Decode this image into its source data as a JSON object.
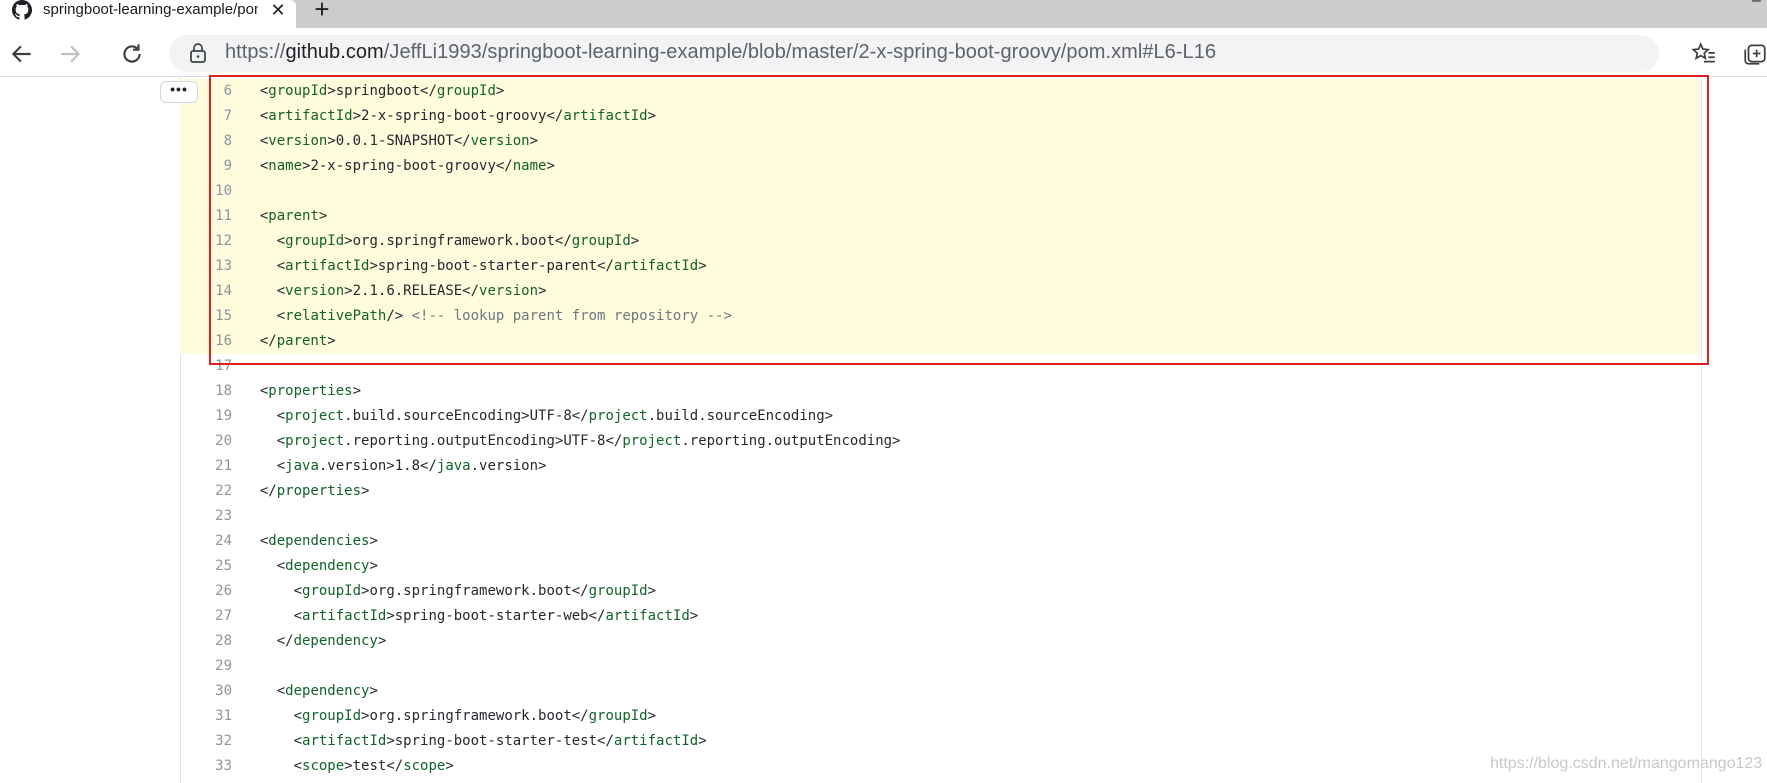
{
  "tab": {
    "title": "springboot-learning-example/pom.xml"
  },
  "address_bar": {
    "url_prefix": "https://",
    "host": "github.com",
    "path": "/JeffLi1993/springboot-learning-example/blob/master/2-x-spring-boot-groovy/pom.xml#L6-L16"
  },
  "expander": {
    "label": "•••"
  },
  "code_lines": [
    {
      "n": "6",
      "hl": true,
      "parts": [
        [
          "p",
          "  <"
        ],
        [
          "t",
          "groupId"
        ],
        [
          "p",
          ">springboot</"
        ],
        [
          "t",
          "groupId"
        ],
        [
          "p",
          ">"
        ]
      ]
    },
    {
      "n": "7",
      "hl": true,
      "parts": [
        [
          "p",
          "  <"
        ],
        [
          "t",
          "artifactId"
        ],
        [
          "p",
          ">2-x-spring-boot-groovy</"
        ],
        [
          "t",
          "artifactId"
        ],
        [
          "p",
          ">"
        ]
      ]
    },
    {
      "n": "8",
      "hl": true,
      "parts": [
        [
          "p",
          "  <"
        ],
        [
          "t",
          "version"
        ],
        [
          "p",
          ">0.0.1-SNAPSHOT</"
        ],
        [
          "t",
          "version"
        ],
        [
          "p",
          ">"
        ]
      ]
    },
    {
      "n": "9",
      "hl": true,
      "parts": [
        [
          "p",
          "  <"
        ],
        [
          "t",
          "name"
        ],
        [
          "p",
          ">2-x-spring-boot-groovy</"
        ],
        [
          "t",
          "name"
        ],
        [
          "p",
          ">"
        ]
      ]
    },
    {
      "n": "10",
      "hl": true,
      "parts": []
    },
    {
      "n": "11",
      "hl": true,
      "parts": [
        [
          "p",
          "  <"
        ],
        [
          "t",
          "parent"
        ],
        [
          "p",
          ">"
        ]
      ]
    },
    {
      "n": "12",
      "hl": true,
      "parts": [
        [
          "p",
          "    <"
        ],
        [
          "t",
          "groupId"
        ],
        [
          "p",
          ">org.springframework.boot</"
        ],
        [
          "t",
          "groupId"
        ],
        [
          "p",
          ">"
        ]
      ]
    },
    {
      "n": "13",
      "hl": true,
      "parts": [
        [
          "p",
          "    <"
        ],
        [
          "t",
          "artifactId"
        ],
        [
          "p",
          ">spring-boot-starter-parent</"
        ],
        [
          "t",
          "artifactId"
        ],
        [
          "p",
          ">"
        ]
      ]
    },
    {
      "n": "14",
      "hl": true,
      "parts": [
        [
          "p",
          "    <"
        ],
        [
          "t",
          "version"
        ],
        [
          "p",
          ">2.1.6.RELEASE</"
        ],
        [
          "t",
          "version"
        ],
        [
          "p",
          ">"
        ]
      ]
    },
    {
      "n": "15",
      "hl": true,
      "parts": [
        [
          "p",
          "    <"
        ],
        [
          "t",
          "relativePath"
        ],
        [
          "p",
          "/> "
        ],
        [
          "c",
          "<!-- lookup parent from repository -->"
        ]
      ]
    },
    {
      "n": "16",
      "hl": true,
      "parts": [
        [
          "p",
          "  </"
        ],
        [
          "t",
          "parent"
        ],
        [
          "p",
          ">"
        ]
      ]
    },
    {
      "n": "17",
      "hl": false,
      "parts": []
    },
    {
      "n": "18",
      "hl": false,
      "parts": [
        [
          "p",
          "  <"
        ],
        [
          "t",
          "properties"
        ],
        [
          "p",
          ">"
        ]
      ]
    },
    {
      "n": "19",
      "hl": false,
      "parts": [
        [
          "p",
          "    <"
        ],
        [
          "t",
          "project"
        ],
        [
          "p",
          ".build.sourceEncoding>UTF-8</"
        ],
        [
          "t",
          "project"
        ],
        [
          "p",
          ".build.sourceEncoding>"
        ]
      ]
    },
    {
      "n": "20",
      "hl": false,
      "parts": [
        [
          "p",
          "    <"
        ],
        [
          "t",
          "project"
        ],
        [
          "p",
          ".reporting.outputEncoding>UTF-8</"
        ],
        [
          "t",
          "project"
        ],
        [
          "p",
          ".reporting.outputEncoding>"
        ]
      ]
    },
    {
      "n": "21",
      "hl": false,
      "parts": [
        [
          "p",
          "    <"
        ],
        [
          "t",
          "java"
        ],
        [
          "p",
          ".version>1.8</"
        ],
        [
          "t",
          "java"
        ],
        [
          "p",
          ".version>"
        ]
      ]
    },
    {
      "n": "22",
      "hl": false,
      "parts": [
        [
          "p",
          "  </"
        ],
        [
          "t",
          "properties"
        ],
        [
          "p",
          ">"
        ]
      ]
    },
    {
      "n": "23",
      "hl": false,
      "parts": []
    },
    {
      "n": "24",
      "hl": false,
      "parts": [
        [
          "p",
          "  <"
        ],
        [
          "t",
          "dependencies"
        ],
        [
          "p",
          ">"
        ]
      ]
    },
    {
      "n": "25",
      "hl": false,
      "parts": [
        [
          "p",
          "    <"
        ],
        [
          "t",
          "dependency"
        ],
        [
          "p",
          ">"
        ]
      ]
    },
    {
      "n": "26",
      "hl": false,
      "parts": [
        [
          "p",
          "      <"
        ],
        [
          "t",
          "groupId"
        ],
        [
          "p",
          ">org.springframework.boot</"
        ],
        [
          "t",
          "groupId"
        ],
        [
          "p",
          ">"
        ]
      ]
    },
    {
      "n": "27",
      "hl": false,
      "parts": [
        [
          "p",
          "      <"
        ],
        [
          "t",
          "artifactId"
        ],
        [
          "p",
          ">spring-boot-starter-web</"
        ],
        [
          "t",
          "artifactId"
        ],
        [
          "p",
          ">"
        ]
      ]
    },
    {
      "n": "28",
      "hl": false,
      "parts": [
        [
          "p",
          "    </"
        ],
        [
          "t",
          "dependency"
        ],
        [
          "p",
          ">"
        ]
      ]
    },
    {
      "n": "29",
      "hl": false,
      "parts": []
    },
    {
      "n": "30",
      "hl": false,
      "parts": [
        [
          "p",
          "    <"
        ],
        [
          "t",
          "dependency"
        ],
        [
          "p",
          ">"
        ]
      ]
    },
    {
      "n": "31",
      "hl": false,
      "parts": [
        [
          "p",
          "      <"
        ],
        [
          "t",
          "groupId"
        ],
        [
          "p",
          ">org.springframework.boot</"
        ],
        [
          "t",
          "groupId"
        ],
        [
          "p",
          ">"
        ]
      ]
    },
    {
      "n": "32",
      "hl": false,
      "parts": [
        [
          "p",
          "      <"
        ],
        [
          "t",
          "artifactId"
        ],
        [
          "p",
          ">spring-boot-starter-test</"
        ],
        [
          "t",
          "artifactId"
        ],
        [
          "p",
          ">"
        ]
      ]
    },
    {
      "n": "33",
      "hl": false,
      "parts": [
        [
          "p",
          "      <"
        ],
        [
          "t",
          "scope"
        ],
        [
          "p",
          ">test</"
        ],
        [
          "t",
          "scope"
        ],
        [
          "p",
          ">"
        ]
      ]
    }
  ],
  "watermark": "https://blog.csdn.net/mangomango123",
  "icons": {
    "favicon": "github-icon",
    "close": "close-icon",
    "new_tab": "plus-icon",
    "back": "back-arrow-icon",
    "forward": "forward-arrow-icon",
    "reload": "reload-icon",
    "lock": "lock-icon",
    "favorite": "add-favorite-icon",
    "favorites": "favorites-icon",
    "collections": "collections-icon"
  },
  "colors": {
    "highlight": "#fffbdd",
    "tag": "#116329",
    "annotation_border": "#e02020",
    "tab_strip": "#cccccc"
  }
}
